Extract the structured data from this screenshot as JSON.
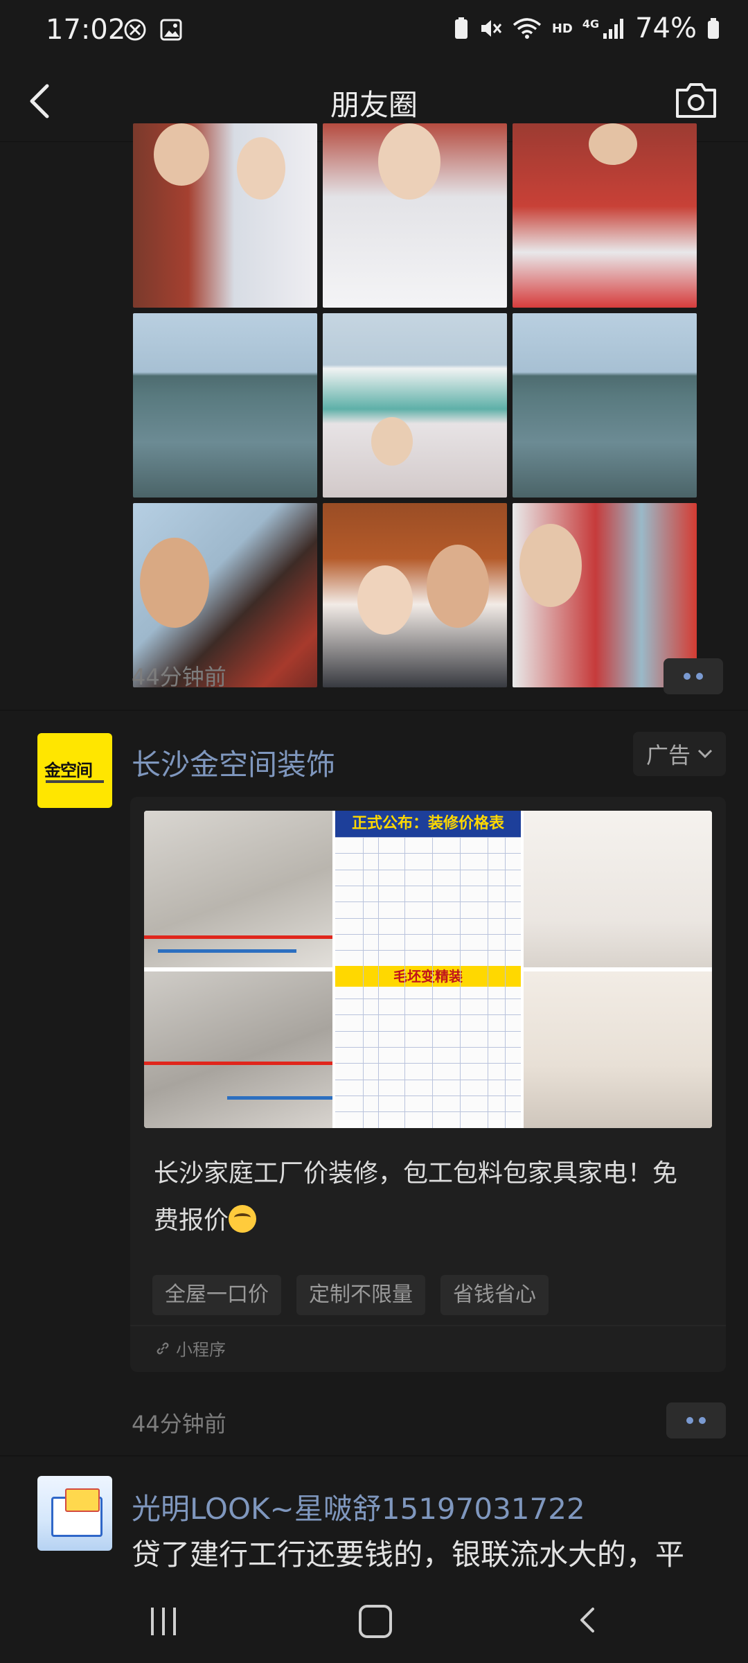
{
  "status_bar": {
    "time": "17:02",
    "battery": "74%",
    "network_hd": "HD",
    "network_4g": "4G"
  },
  "header": {
    "title": "朋友圈"
  },
  "post1": {
    "time": "44分钟前"
  },
  "ad": {
    "avatar_text": "金空间",
    "name": "长沙金空间装饰",
    "tag": "广告",
    "image_title": "正式公布：装修价格表",
    "image_subtitle": "毛坯变精装",
    "text": "长沙家庭工厂价装修，包工包料包家具家电！免费报价",
    "chips": [
      "全屋一口价",
      "定制不限量",
      "省钱省心"
    ],
    "footer": "小程序",
    "time": "44分钟前"
  },
  "post3": {
    "name": "光明LOOK~星啵舒15197031722",
    "text": "贷了建行工行还要钱的，银联流水大的，平"
  },
  "colors": {
    "background": "#191919",
    "name_link": "#7f97be",
    "more_dots": "#7a9ad1",
    "ad_avatar_bg": "#ffe600"
  }
}
